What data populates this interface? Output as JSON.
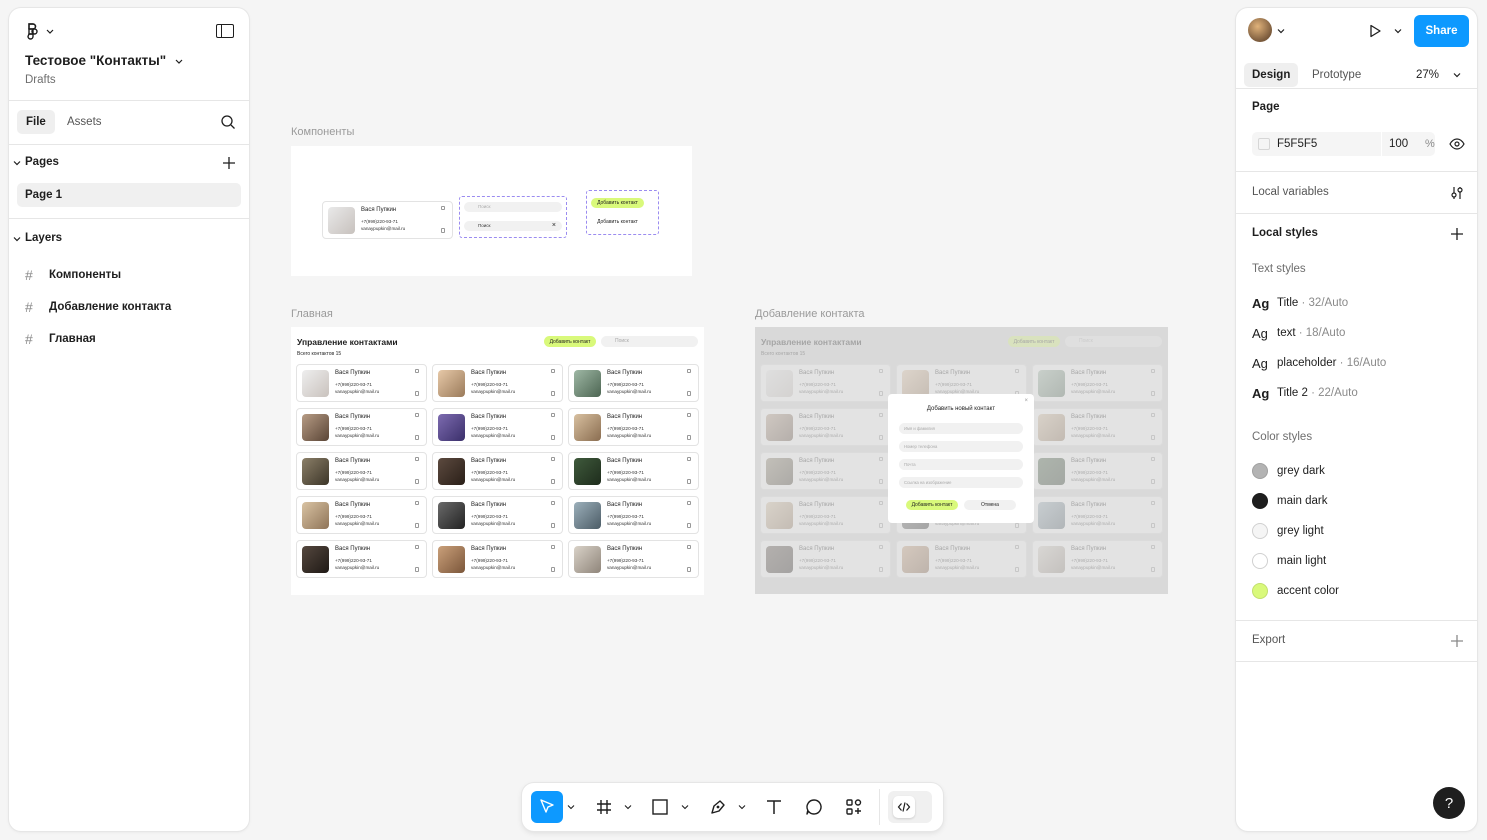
{
  "file": {
    "title": "Тестовое \"Контакты\"",
    "location": "Drafts"
  },
  "left_tabs": {
    "file": "File",
    "assets": "Assets"
  },
  "pages": {
    "heading": "Pages",
    "items": [
      {
        "label": "Page 1"
      }
    ]
  },
  "layers": {
    "heading": "Layers",
    "items": [
      {
        "label": "Компоненты"
      },
      {
        "label": "Добавление контакта"
      },
      {
        "label": "Главная"
      }
    ]
  },
  "canvas": {
    "frames": [
      {
        "label": "Компоненты"
      },
      {
        "label": "Главная"
      },
      {
        "label": "Добавление контакта"
      }
    ],
    "components": {
      "card": {
        "name": "Вася Пупкин",
        "phone": "+7(999)220-93-71",
        "email": "vanaypupkin@mail.ru"
      },
      "search_placeholder": "Поиск",
      "search_filled": "Поиск",
      "add_button": "Добавить контакт",
      "add_button_alt": "Добавить контакт"
    },
    "main": {
      "title": "Управление контактами",
      "subtitle": "Всего контактов 15",
      "add_button": "Добавить контакт",
      "search_placeholder": "Поиск",
      "card": {
        "name": "Вася Пупкин",
        "phone": "+7(999)220-93-71",
        "email": "vanaypupkin@mail.ru"
      }
    },
    "modal": {
      "title": "Добавить новый контакт",
      "fields": [
        "Имя и фамилия",
        "Номер телефона",
        "Почта",
        "Ссылка на изображение"
      ],
      "submit": "Добавить контакт",
      "cancel": "Отмена"
    }
  },
  "right": {
    "tabs": {
      "design": "Design",
      "prototype": "Prototype"
    },
    "zoom": "27%",
    "share": "Share",
    "page": {
      "heading": "Page",
      "color": "F5F5F5",
      "opacity": "100",
      "unit": "%"
    },
    "local_variables": "Local variables",
    "local_styles": "Local styles",
    "text_styles": {
      "heading": "Text styles",
      "items": [
        {
          "glyph": "Ag",
          "name": "Title",
          "spec": " · 32/Auto",
          "bold": true
        },
        {
          "glyph": "Ag",
          "name": "text",
          "spec": " · 18/Auto",
          "bold": false
        },
        {
          "glyph": "Ag",
          "name": "placeholder",
          "spec": " · 16/Auto",
          "bold": false
        },
        {
          "glyph": "Ag",
          "name": "Title 2",
          "spec": " · 22/Auto",
          "bold": true
        }
      ]
    },
    "color_styles": {
      "heading": "Color styles",
      "items": [
        {
          "name": "grey dark",
          "color": "#b3b3b3"
        },
        {
          "name": "main dark",
          "color": "#1e1e1e"
        },
        {
          "name": "grey light",
          "color": "#f5f5f5"
        },
        {
          "name": "main light",
          "color": "#ffffff"
        },
        {
          "name": "accent color",
          "color": "#d9f97b"
        }
      ]
    },
    "export": "Export",
    "help": "?"
  },
  "colors": {
    "accent": "#d9f97b",
    "primary_blue": "#0d99ff"
  }
}
